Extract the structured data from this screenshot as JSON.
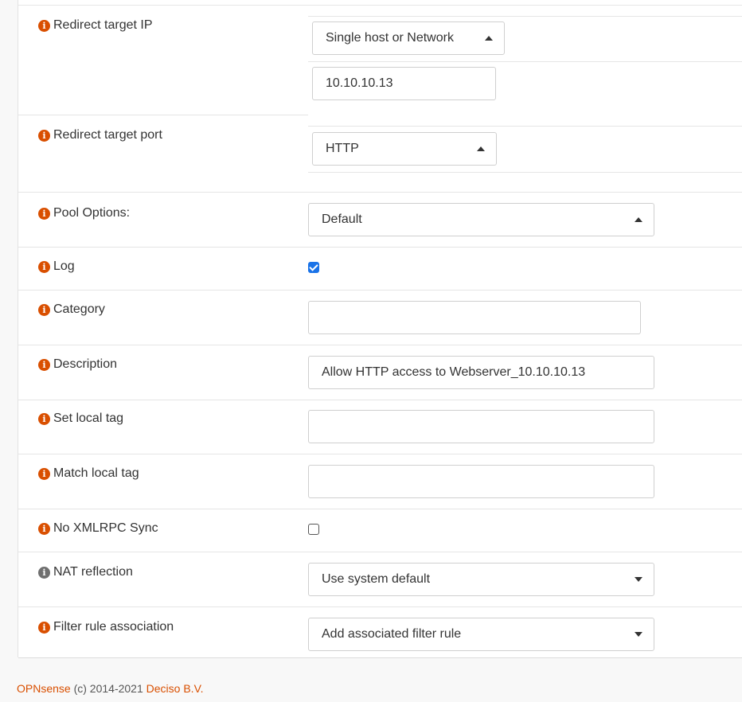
{
  "fields": {
    "redirect_ip": {
      "label": "Redirect target IP",
      "type_select": "Single host or Network",
      "address_value": "10.10.10.13"
    },
    "redirect_port": {
      "label": "Redirect target port",
      "select": "HTTP"
    },
    "pool_options": {
      "label": "Pool Options:",
      "select": "Default"
    },
    "log": {
      "label": "Log",
      "checked": true
    },
    "category": {
      "label": "Category",
      "value": ""
    },
    "description": {
      "label": "Description",
      "value": "Allow HTTP access to Webserver_10.10.10.13"
    },
    "set_local_tag": {
      "label": "Set local tag",
      "value": ""
    },
    "match_local_tag": {
      "label": "Match local tag",
      "value": ""
    },
    "no_xmlrpc_sync": {
      "label": "No XMLRPC Sync",
      "checked": false
    },
    "nat_reflection": {
      "label": "NAT reflection",
      "select": "Use system default"
    },
    "filter_rule_association": {
      "label": "Filter rule association",
      "select": "Add associated filter rule"
    }
  },
  "icons": {
    "info": "info-circle-icon"
  },
  "colors": {
    "accent": "#d94f00",
    "checkbox": "#1a73e8"
  },
  "footer": {
    "brand": "OPNsense",
    "copyright": "(c) 2014-2021",
    "company": "Deciso B.V."
  }
}
